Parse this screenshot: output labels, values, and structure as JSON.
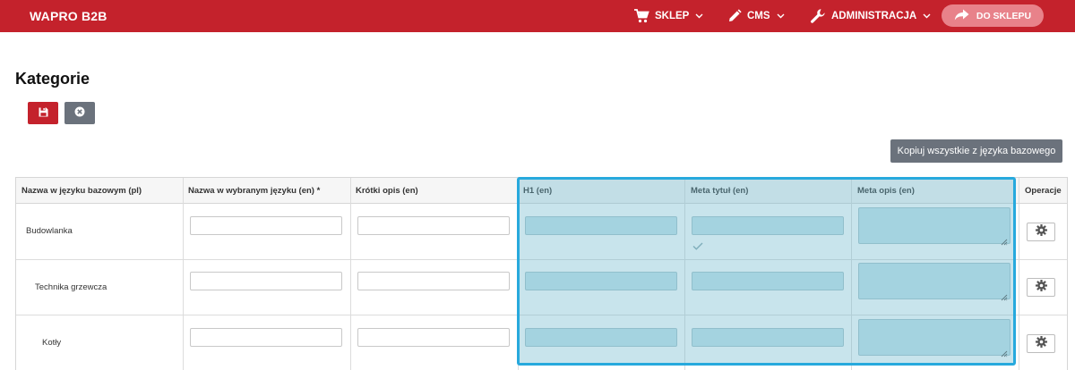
{
  "navbar": {
    "brand": "WAPRO B2B",
    "items": [
      {
        "label": "SKLEP",
        "icon": "cart-icon"
      },
      {
        "label": "CMS",
        "icon": "pencil-icon"
      },
      {
        "label": "ADMINISTRACJA",
        "icon": "wrench-icon"
      }
    ],
    "store_button": "DO SKLEPU"
  },
  "page": {
    "title": "Kategorie",
    "copy_button": "Kopiuj wszystkie z języka bazowego"
  },
  "table": {
    "columns": [
      "Nazwa w języku bazowym (pl)",
      "Nazwa w wybranym języku (en) *",
      "Krótki opis (en)",
      "H1 (en)",
      "Meta tytuł (en)",
      "Meta opis (en)",
      "Operacje"
    ],
    "rows": [
      {
        "name": "Budowlanka"
      },
      {
        "name": "Technika grzewcza"
      },
      {
        "name": "Kotły"
      }
    ]
  },
  "colors": {
    "brand_red": "#c4222c",
    "highlight_border": "#27a9dd",
    "highlight_fill": "#c6e4ec",
    "secondary_button": "#6b727c"
  }
}
